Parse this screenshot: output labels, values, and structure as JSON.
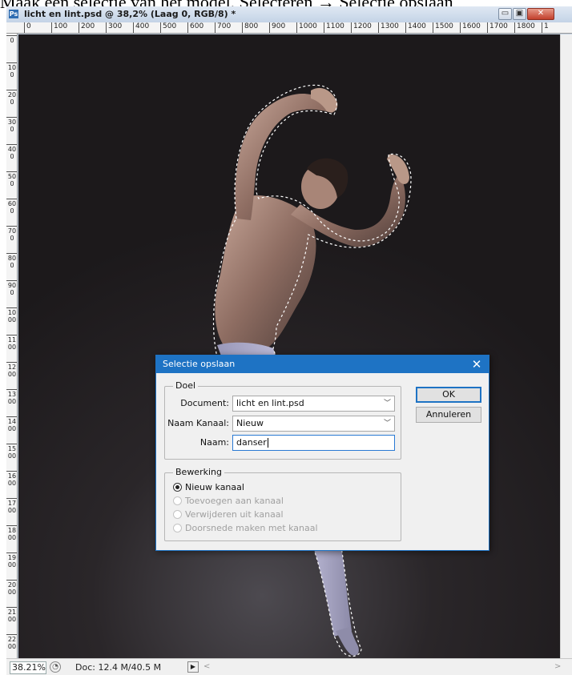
{
  "caption": "Maak een selectie van het model, Selecteren → Selectie opslaan",
  "window": {
    "title": "licht en lint.psd @ 38,2% (Laag 0, RGB/8) *",
    "buttons": {
      "minimize": "▭",
      "maximize": "▣",
      "close": "✕"
    }
  },
  "rulers": {
    "horizontal": [
      "0",
      "100",
      "200",
      "300",
      "400",
      "500",
      "600",
      "700",
      "800",
      "900",
      "1000",
      "1100",
      "1200",
      "1300",
      "1400",
      "1500",
      "1600",
      "1700",
      "1800",
      "1"
    ],
    "vertical": [
      "0",
      "100",
      "200",
      "300",
      "400",
      "500",
      "600",
      "700",
      "800",
      "900",
      "1000",
      "1100",
      "1200",
      "1300",
      "1400",
      "1500",
      "1600",
      "1700",
      "1800",
      "1900",
      "2000",
      "2100",
      "2200"
    ]
  },
  "status": {
    "zoom": "38.21%",
    "doc": "Doc: 12.4 M/40.5 M"
  },
  "dialog": {
    "title": "Selectie opslaan",
    "close": "✕",
    "target_group": "Doel",
    "document_label": "Document:",
    "document_value": "licht en lint.psd",
    "channel_label": "Naam Kanaal:",
    "channel_value": "Nieuw",
    "name_label": "Naam:",
    "name_value": "danser",
    "ok": "OK",
    "cancel": "Annuleren",
    "operation_group": "Bewerking",
    "operations": [
      {
        "label": "Nieuw kanaal",
        "checked": true,
        "enabled": true
      },
      {
        "label": "Toevoegen aan kanaal",
        "checked": false,
        "enabled": false
      },
      {
        "label": "Verwijderen uit kanaal",
        "checked": false,
        "enabled": false
      },
      {
        "label": "Doorsnede maken met kanaal",
        "checked": false,
        "enabled": false
      }
    ]
  }
}
